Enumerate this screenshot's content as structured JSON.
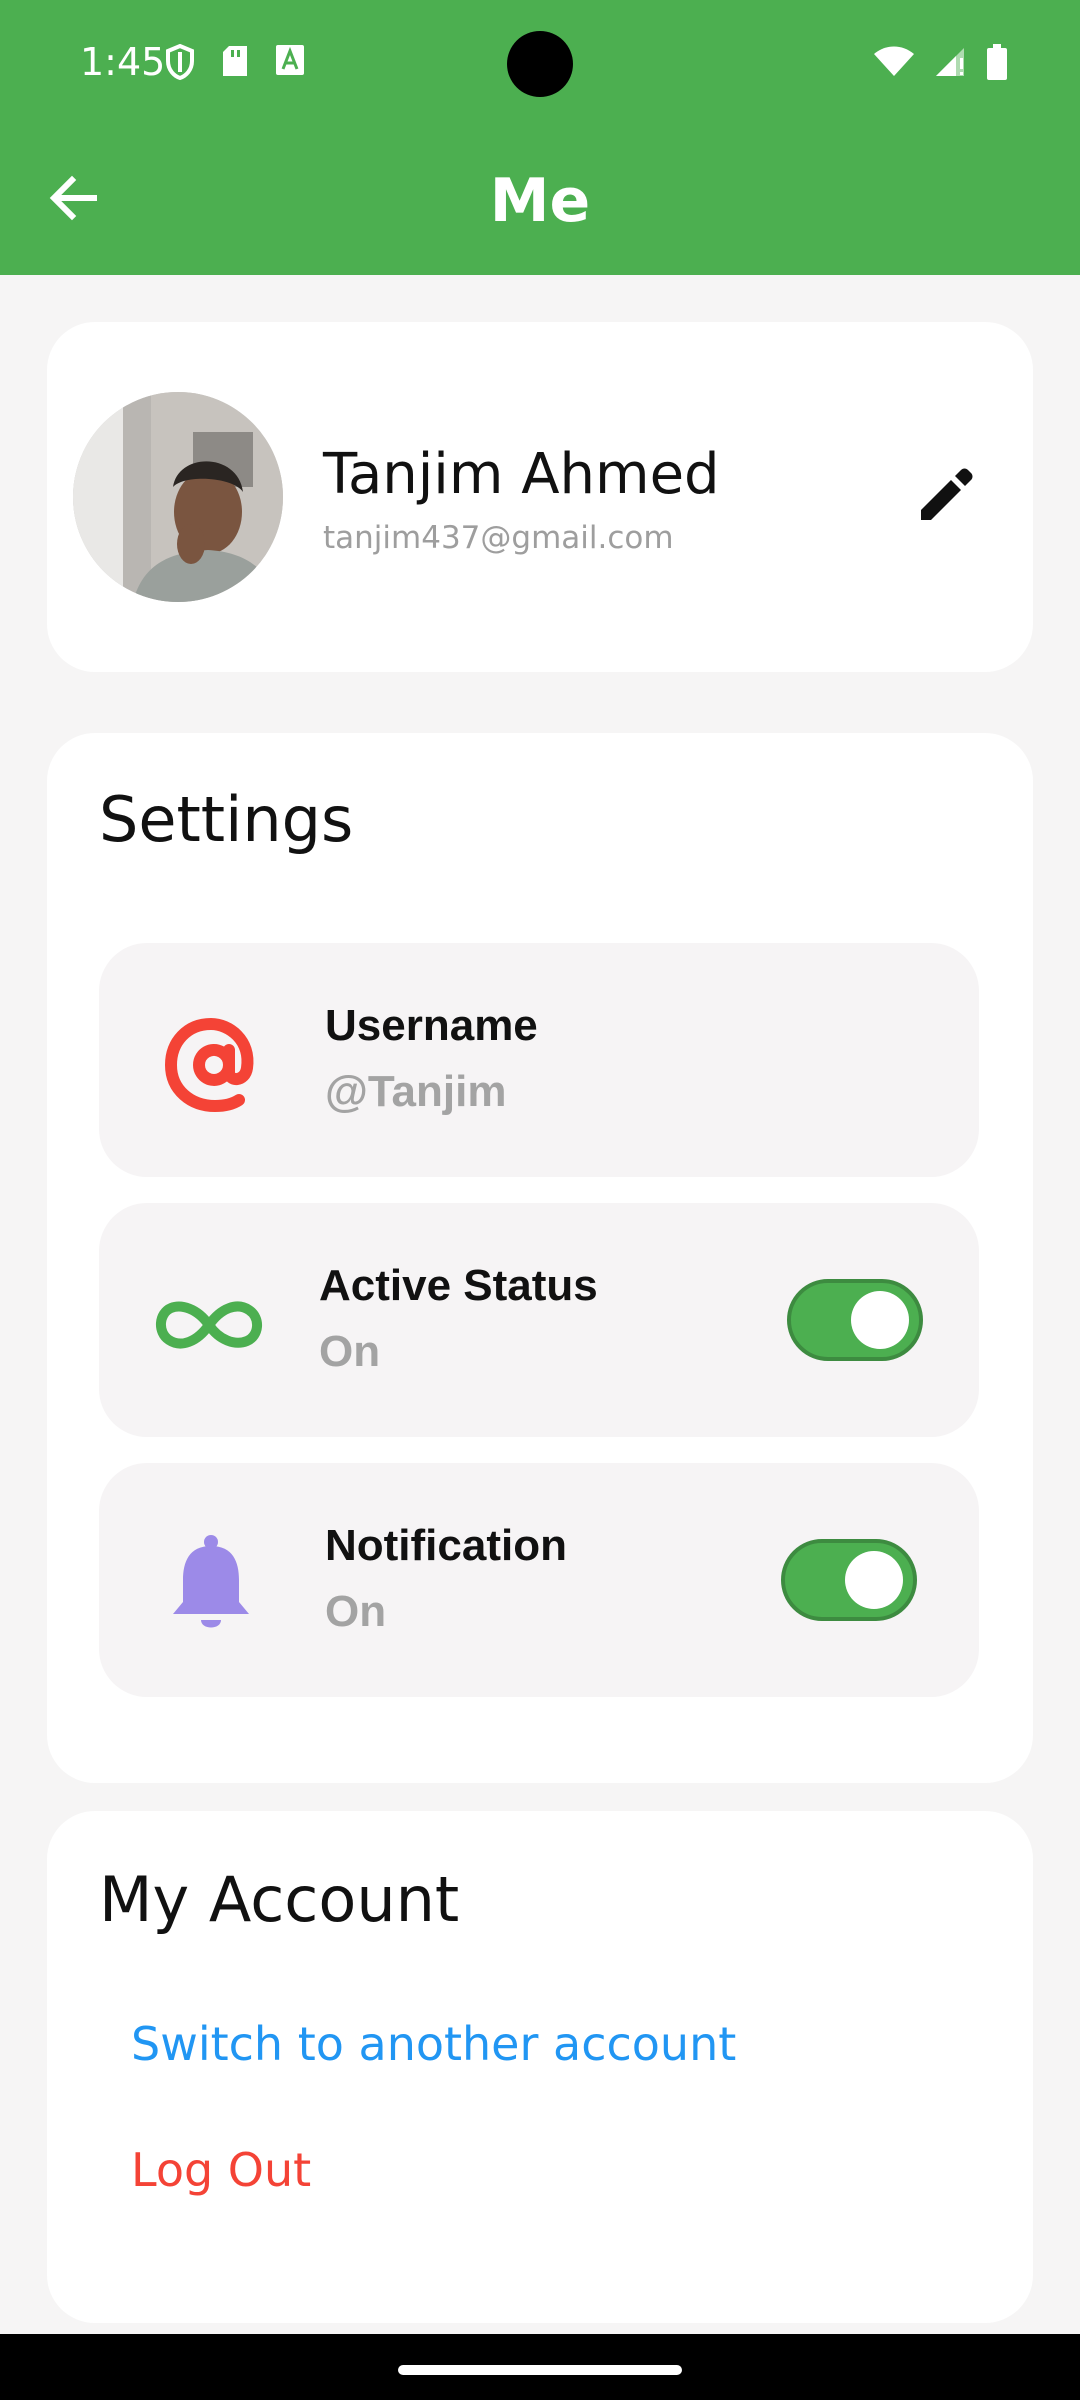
{
  "status_bar": {
    "time": "1:45",
    "icons_left": [
      "shield-icon",
      "sd-card-icon",
      "font-icon"
    ],
    "icons_right": [
      "wifi-icon",
      "signal-icon",
      "battery-icon"
    ]
  },
  "app_bar": {
    "title": "Me",
    "back_icon": "arrow-back-icon",
    "color": "#4caf50"
  },
  "profile": {
    "name": "Tanjim Ahmed",
    "email": "tanjim437@gmail.com",
    "edit_icon": "pencil-icon"
  },
  "settings": {
    "title": "Settings",
    "items": [
      {
        "label": "Username",
        "value": "@Tanjim",
        "icon": "at-icon",
        "icon_color": "#f44336"
      },
      {
        "label": "Active Status",
        "value": "On",
        "icon": "infinity-icon",
        "icon_color": "#4caf50",
        "toggle_on": true
      },
      {
        "label": "Notification",
        "value": "On",
        "icon": "bell-icon",
        "icon_color": "#9c8ae8",
        "toggle_on": true
      }
    ]
  },
  "account": {
    "title": "My Account",
    "switch_label": "Switch to another account",
    "logout_label": "Log Out",
    "switch_color": "#2196f3",
    "logout_color": "#f44336"
  }
}
